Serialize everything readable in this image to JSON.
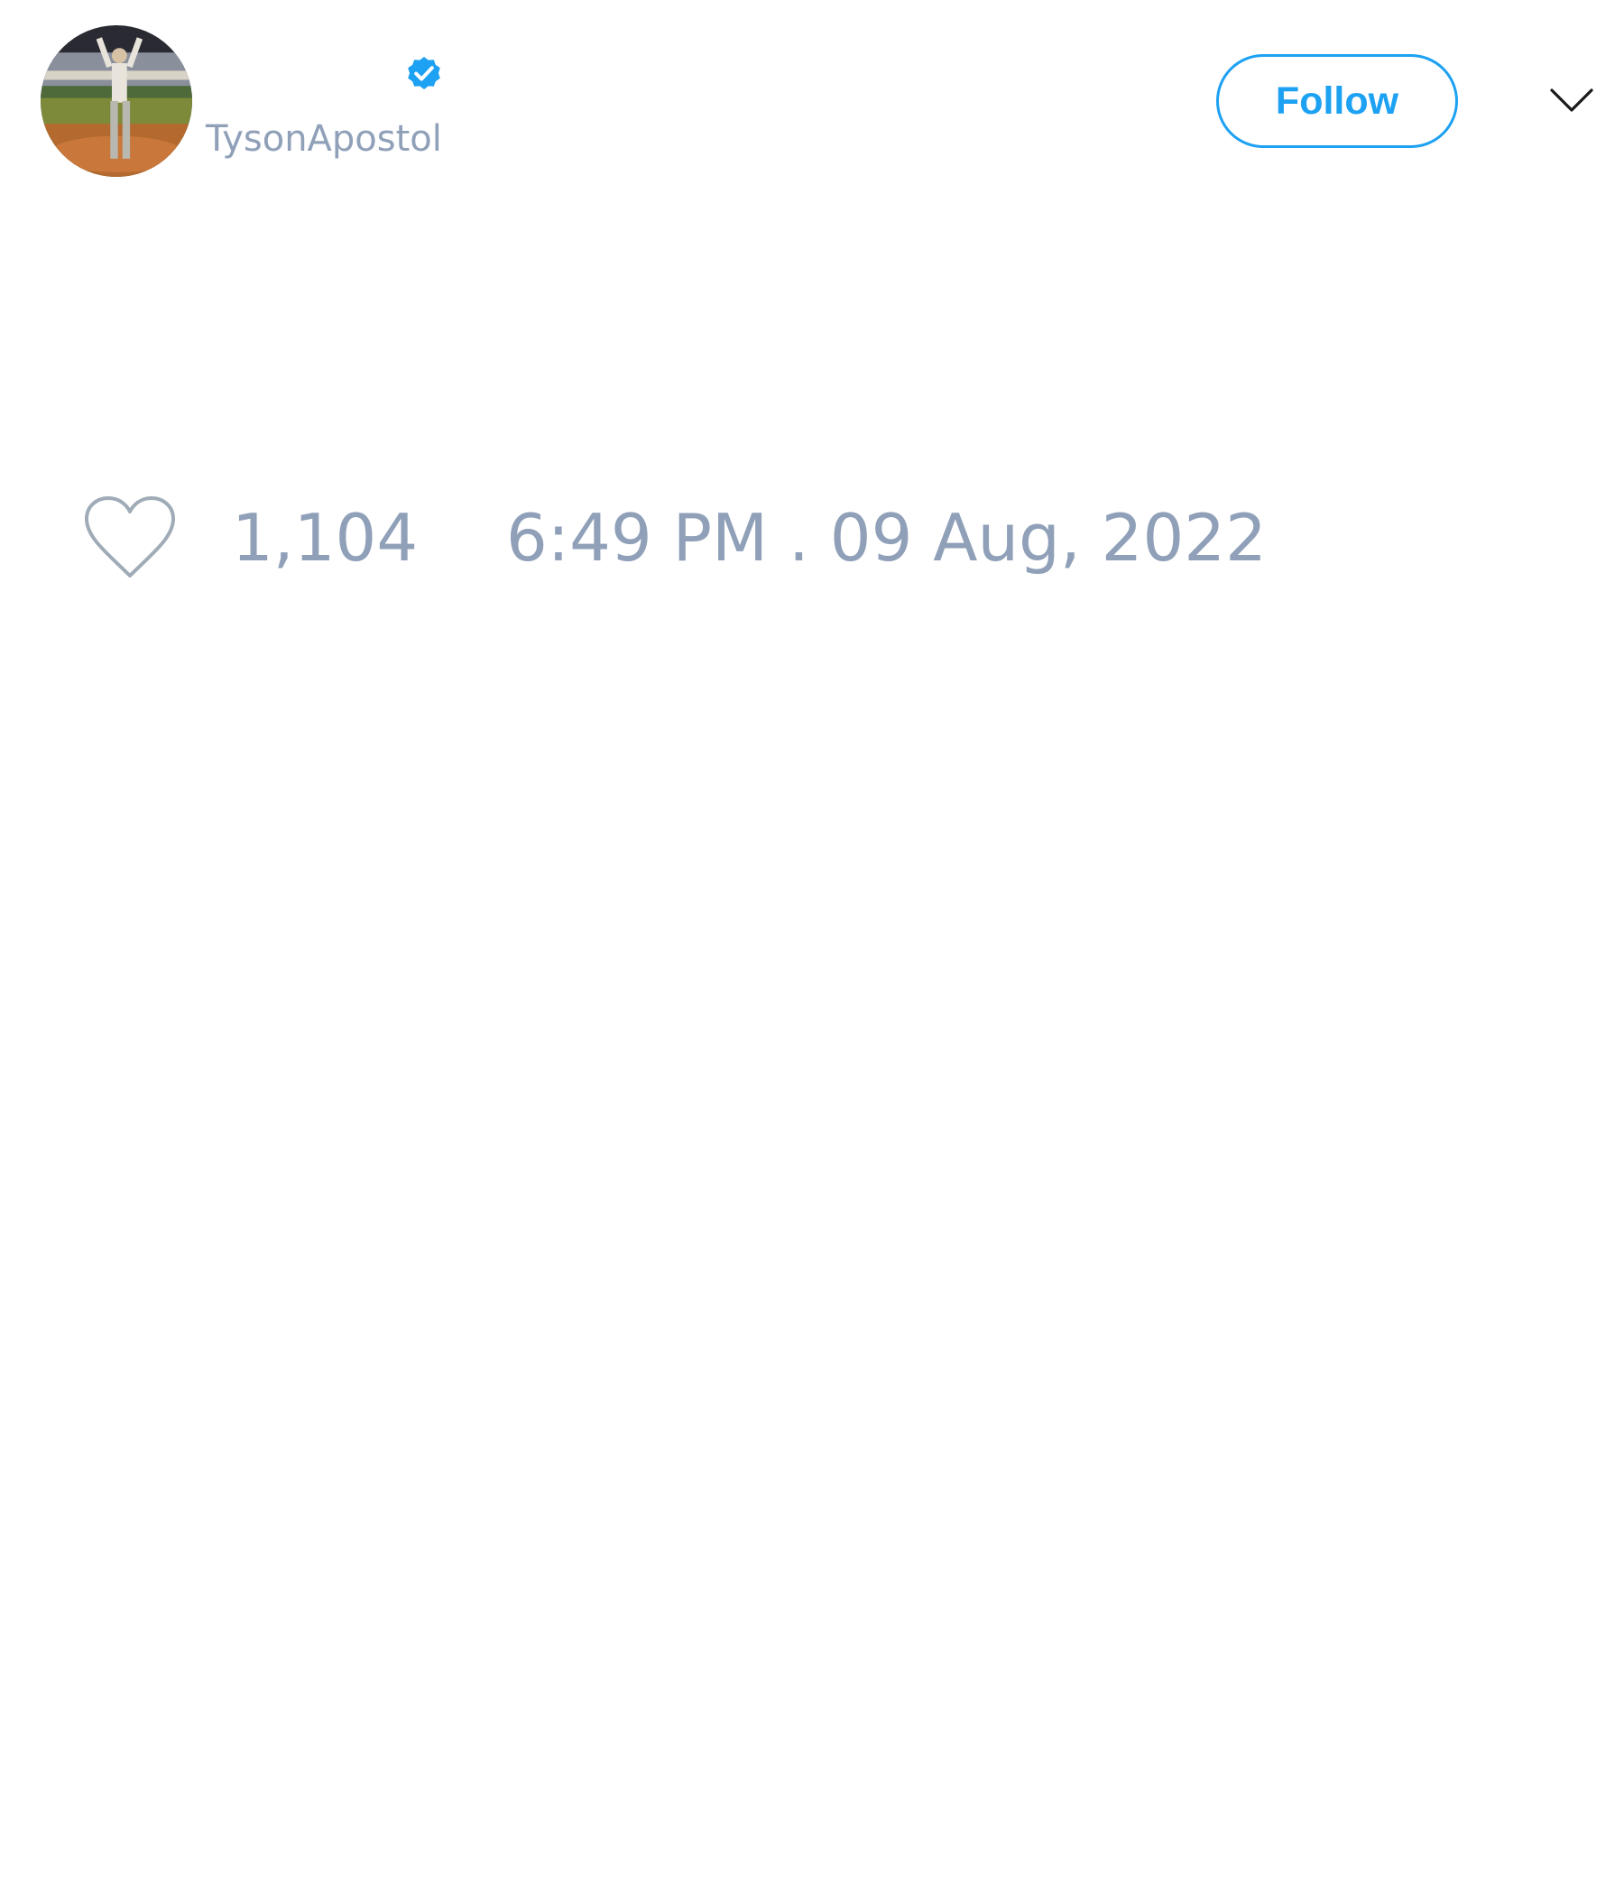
{
  "author": {
    "handle": "TysonApostol",
    "verified": true,
    "avatar_icon": "baseball-field-avatar"
  },
  "header": {
    "follow_label": "Follow",
    "menu_icon": "chevron-down-icon"
  },
  "stats": {
    "likes": "1,104",
    "like_icon": "heart-icon",
    "timestamp": "6:49 PM . 09 Aug, 2022"
  },
  "colors": {
    "accent": "#1da1f2",
    "muted_text": "#8fa0b8",
    "icon_gray": "#a0abb8"
  }
}
